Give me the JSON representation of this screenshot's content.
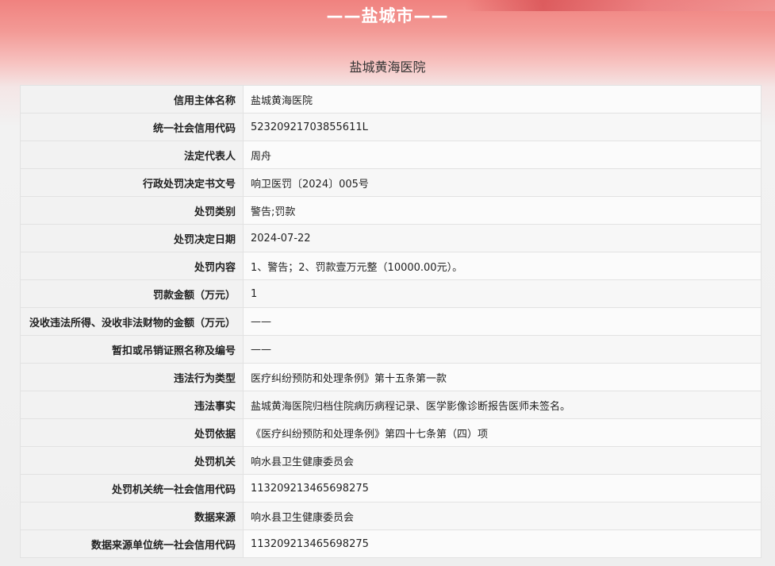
{
  "header": {
    "city_title": "——盐城市——",
    "org_name": "盐城黄海医院"
  },
  "records": [
    {
      "label": "信用主体名称",
      "value": "盐城黄海医院"
    },
    {
      "label": "统一社会信用代码",
      "value": "52320921703855611L"
    },
    {
      "label": "法定代表人",
      "value": "周舟"
    },
    {
      "label": "行政处罚决定书文号",
      "value": "响卫医罚〔2024〕005号"
    },
    {
      "label": "处罚类别",
      "value": "警告;罚款"
    },
    {
      "label": "处罚决定日期",
      "value": "2024-07-22"
    },
    {
      "label": "处罚内容",
      "value": "1、警告；2、罚款壹万元整（10000.00元）。"
    },
    {
      "label": "罚款金额（万元）",
      "value": "1"
    },
    {
      "label": "没收违法所得、没收非法财物的金额（万元）",
      "value": "——"
    },
    {
      "label": "暂扣或吊销证照名称及编号",
      "value": "——"
    },
    {
      "label": "违法行为类型",
      "value": "医疗纠纷预防和处理条例》第十五条第一款"
    },
    {
      "label": "违法事实",
      "value": "盐城黄海医院归档住院病历病程记录、医学影像诊断报告医师未签名。"
    },
    {
      "label": "处罚依据",
      "value": "《医疗纠纷预防和处理条例》第四十七条第（四）项"
    },
    {
      "label": "处罚机关",
      "value": "响水县卫生健康委员会"
    },
    {
      "label": "处罚机关统一社会信用代码",
      "value": "113209213465698275"
    },
    {
      "label": "数据来源",
      "value": "响水县卫生健康委员会"
    },
    {
      "label": "数据来源单位统一社会信用代码",
      "value": "113209213465698275"
    }
  ]
}
